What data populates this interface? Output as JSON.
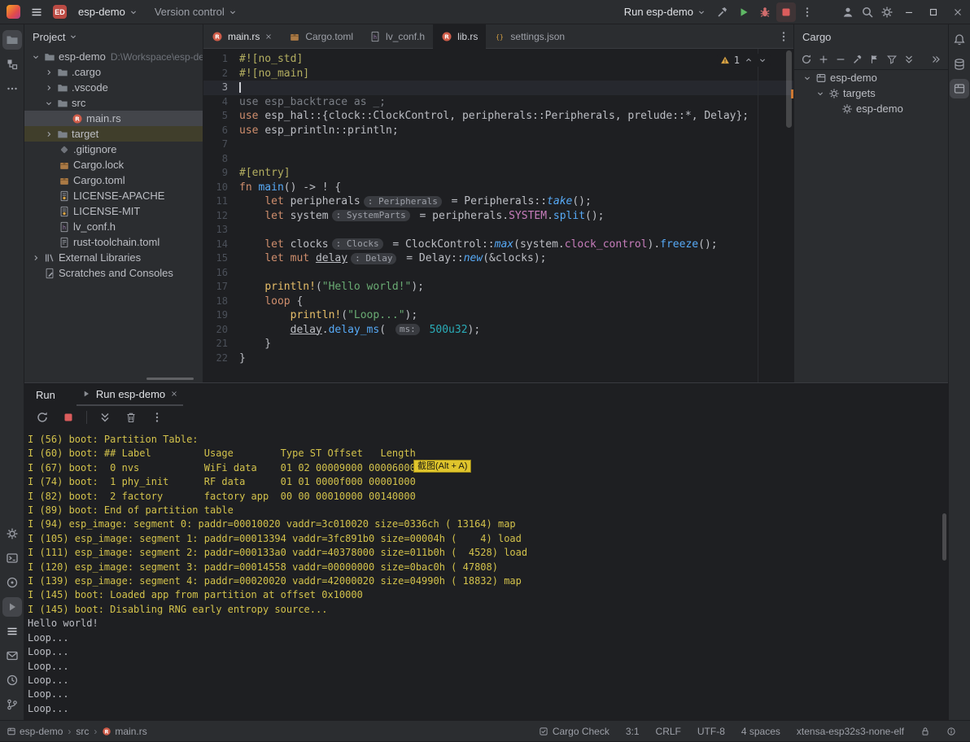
{
  "titlebar": {
    "project_badge": "ED",
    "project_name": "esp-demo",
    "vcs_label": "Version control",
    "run_config": "Run esp-demo"
  },
  "colors": {
    "run_green": "#5fb865",
    "stop_red": "#db5c5c",
    "warning_yellow": "#d9a343",
    "console_yellow": "#d3c24b",
    "rust_orange": "#cf5c49",
    "overlay_yellow": "#e0c52c"
  },
  "project_panel": {
    "title": "Project",
    "tree": [
      {
        "label": "esp-demo",
        "path": "D:\\Workspace\\esp-dem"
      },
      {
        "label": ".cargo"
      },
      {
        "label": ".vscode"
      },
      {
        "label": "src"
      },
      {
        "label": "main.rs"
      },
      {
        "label": "target"
      },
      {
        "label": ".gitignore"
      },
      {
        "label": "Cargo.lock"
      },
      {
        "label": "Cargo.toml"
      },
      {
        "label": "LICENSE-APACHE"
      },
      {
        "label": "LICENSE-MIT"
      },
      {
        "label": "lv_conf.h"
      },
      {
        "label": "rust-toolchain.toml"
      },
      {
        "label": "External Libraries"
      },
      {
        "label": "Scratches and Consoles"
      }
    ]
  },
  "editor": {
    "tabs": [
      {
        "label": "main.rs"
      },
      {
        "label": "Cargo.toml"
      },
      {
        "label": "lv_conf.h"
      },
      {
        "label": "lib.rs"
      },
      {
        "label": "settings.json"
      }
    ],
    "inspections": {
      "warning_count": "1"
    },
    "lines": [
      {
        "num": "1",
        "tokens": [
          {
            "t": "#![no_std]",
            "c": "attr"
          }
        ]
      },
      {
        "num": "2",
        "tokens": [
          {
            "t": "#![no_main]",
            "c": "attr"
          }
        ]
      },
      {
        "num": "3",
        "tokens": []
      },
      {
        "num": "4",
        "tokens": [
          {
            "t": "use esp_backtrace as _;",
            "c": "gray"
          }
        ]
      },
      {
        "num": "5",
        "tokens": [
          {
            "t": "use ",
            "c": "kw"
          },
          {
            "t": "esp_hal::{clock::ClockControl, peripherals::Peripherals, prelude::*, Delay};",
            "c": "p"
          }
        ]
      },
      {
        "num": "6",
        "tokens": [
          {
            "t": "use ",
            "c": "kw"
          },
          {
            "t": "esp_println::println;",
            "c": "p"
          }
        ]
      },
      {
        "num": "7",
        "tokens": []
      },
      {
        "num": "8",
        "tokens": []
      },
      {
        "num": "9",
        "tokens": [
          {
            "t": "#[entry]",
            "c": "attr"
          }
        ]
      },
      {
        "num": "10",
        "tokens": [
          {
            "t": "fn ",
            "c": "kw"
          },
          {
            "t": "main",
            "c": "fn"
          },
          {
            "t": "() -> ! {",
            "c": "p"
          }
        ]
      },
      {
        "num": "11",
        "tokens": [
          {
            "t": "    ",
            "c": "p"
          },
          {
            "t": "let ",
            "c": "kw"
          },
          {
            "t": "peripherals",
            "c": "p"
          },
          {
            "t": ": Peripherals",
            "c": "hint"
          },
          {
            "t": " = Peripherals::",
            "c": "p"
          },
          {
            "t": "take",
            "c": "fni"
          },
          {
            "t": "();",
            "c": "p"
          }
        ]
      },
      {
        "num": "12",
        "tokens": [
          {
            "t": "    ",
            "c": "p"
          },
          {
            "t": "let ",
            "c": "kw"
          },
          {
            "t": "system",
            "c": "p"
          },
          {
            "t": ": SystemParts",
            "c": "hint"
          },
          {
            "t": " = peripherals.",
            "c": "p"
          },
          {
            "t": "SYSTEM",
            "c": "field"
          },
          {
            "t": ".",
            "c": "p"
          },
          {
            "t": "split",
            "c": "fn"
          },
          {
            "t": "();",
            "c": "p"
          }
        ]
      },
      {
        "num": "13",
        "tokens": []
      },
      {
        "num": "14",
        "tokens": [
          {
            "t": "    ",
            "c": "p"
          },
          {
            "t": "let ",
            "c": "kw"
          },
          {
            "t": "clocks",
            "c": "p"
          },
          {
            "t": ": Clocks",
            "c": "hint"
          },
          {
            "t": " = ClockControl::",
            "c": "p"
          },
          {
            "t": "max",
            "c": "fni"
          },
          {
            "t": "(system.",
            "c": "p"
          },
          {
            "t": "clock_control",
            "c": "field"
          },
          {
            "t": ").",
            "c": "p"
          },
          {
            "t": "freeze",
            "c": "fn"
          },
          {
            "t": "();",
            "c": "p"
          }
        ]
      },
      {
        "num": "15",
        "tokens": [
          {
            "t": "    ",
            "c": "p"
          },
          {
            "t": "let mut ",
            "c": "kw"
          },
          {
            "t": "delay",
            "c": "ul"
          },
          {
            "t": ": Delay",
            "c": "hint"
          },
          {
            "t": " = Delay::",
            "c": "p"
          },
          {
            "t": "new",
            "c": "fni"
          },
          {
            "t": "(&clocks);",
            "c": "p"
          }
        ]
      },
      {
        "num": "16",
        "tokens": []
      },
      {
        "num": "17",
        "tokens": [
          {
            "t": "    ",
            "c": "p"
          },
          {
            "t": "println!",
            "c": "mac"
          },
          {
            "t": "(",
            "c": "p"
          },
          {
            "t": "\"Hello world!\"",
            "c": "str"
          },
          {
            "t": ");",
            "c": "p"
          }
        ]
      },
      {
        "num": "18",
        "tokens": [
          {
            "t": "    ",
            "c": "p"
          },
          {
            "t": "loop",
            "c": "kw"
          },
          {
            "t": " {",
            "c": "p"
          }
        ]
      },
      {
        "num": "19",
        "tokens": [
          {
            "t": "        ",
            "c": "p"
          },
          {
            "t": "println!",
            "c": "mac"
          },
          {
            "t": "(",
            "c": "p"
          },
          {
            "t": "\"Loop...\"",
            "c": "str"
          },
          {
            "t": ");",
            "c": "p"
          }
        ]
      },
      {
        "num": "20",
        "tokens": [
          {
            "t": "        ",
            "c": "p"
          },
          {
            "t": "delay",
            "c": "ul"
          },
          {
            "t": ".",
            "c": "p"
          },
          {
            "t": "delay_ms",
            "c": "fn"
          },
          {
            "t": "( ",
            "c": "p"
          },
          {
            "t": "ms:",
            "c": "hint"
          },
          {
            "t": " ",
            "c": "p"
          },
          {
            "t": "500u32",
            "c": "num"
          },
          {
            "t": ");",
            "c": "p"
          }
        ]
      },
      {
        "num": "21",
        "tokens": [
          {
            "t": "    }",
            "c": "p"
          }
        ]
      },
      {
        "num": "22",
        "tokens": [
          {
            "t": "}",
            "c": "p"
          }
        ]
      }
    ]
  },
  "cargo_panel": {
    "title": "Cargo",
    "tree": [
      {
        "label": "esp-demo"
      },
      {
        "label": "targets"
      },
      {
        "label": "esp-demo"
      }
    ]
  },
  "run_panel": {
    "tool_label": "Run",
    "tab": "Run esp-demo",
    "overlay_label": "截图(Alt + A)",
    "console": [
      {
        "t": "I (56) boot: Partition Table:",
        "c": "y"
      },
      {
        "t": "I (60) boot: ## Label         Usage        Type ST Offset   Length",
        "c": "y"
      },
      {
        "t": "I (67) boot:  0 nvs           WiFi data    01 02 00009000 00006000",
        "c": "y"
      },
      {
        "t": "I (74) boot:  1 phy_init      RF data      01 01 0000f000 00001000",
        "c": "y"
      },
      {
        "t": "I (82) boot:  2 factory       factory app  00 00 00010000 00140000",
        "c": "y"
      },
      {
        "t": "I (89) boot: End of partition table",
        "c": "y"
      },
      {
        "t": "I (94) esp_image: segment 0: paddr=00010020 vaddr=3c010020 size=0336ch ( 13164) map",
        "c": "y"
      },
      {
        "t": "I (105) esp_image: segment 1: paddr=00013394 vaddr=3fc891b0 size=00004h (    4) load",
        "c": "y"
      },
      {
        "t": "I (111) esp_image: segment 2: paddr=000133a0 vaddr=40378000 size=011b0h (  4528) load",
        "c": "y"
      },
      {
        "t": "I (120) esp_image: segment 3: paddr=00014558 vaddr=00000000 size=0bac0h ( 47808)",
        "c": "y"
      },
      {
        "t": "I (139) esp_image: segment 4: paddr=00020020 vaddr=42000020 size=04990h ( 18832) map",
        "c": "y"
      },
      {
        "t": "I (145) boot: Loaded app from partition at offset 0x10000",
        "c": "y"
      },
      {
        "t": "I (145) boot: Disabling RNG early entropy source...",
        "c": "y"
      },
      {
        "t": "Hello world!",
        "c": "p"
      },
      {
        "t": "Loop...",
        "c": "p"
      },
      {
        "t": "Loop...",
        "c": "p"
      },
      {
        "t": "Loop...",
        "c": "p"
      },
      {
        "t": "Loop...",
        "c": "p"
      },
      {
        "t": "Loop...",
        "c": "p"
      },
      {
        "t": "Loop...",
        "c": "p"
      }
    ]
  },
  "statusbar": {
    "breadcrumbs": [
      "esp-demo",
      "src",
      "main.rs"
    ],
    "items": [
      "Cargo Check",
      "3:1",
      "CRLF",
      "UTF-8",
      "4 spaces",
      "xtensa-esp32s3-none-elf"
    ]
  }
}
